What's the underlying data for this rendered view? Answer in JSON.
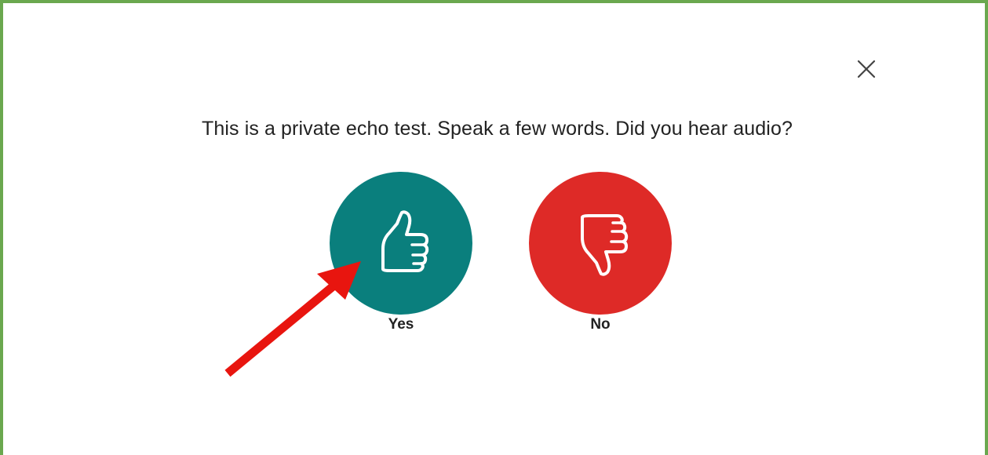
{
  "dialog": {
    "question": "This is a private echo test. Speak a few words. Did you hear audio?",
    "close_icon": "close-icon",
    "choices": [
      {
        "label": "Yes",
        "icon": "thumbs-up-icon",
        "color": "#0a7f7d"
      },
      {
        "label": "No",
        "icon": "thumbs-down-icon",
        "color": "#de2a27"
      }
    ]
  },
  "annotation": {
    "arrow_color": "#e8150f",
    "frame_color": "#6aa84f"
  }
}
